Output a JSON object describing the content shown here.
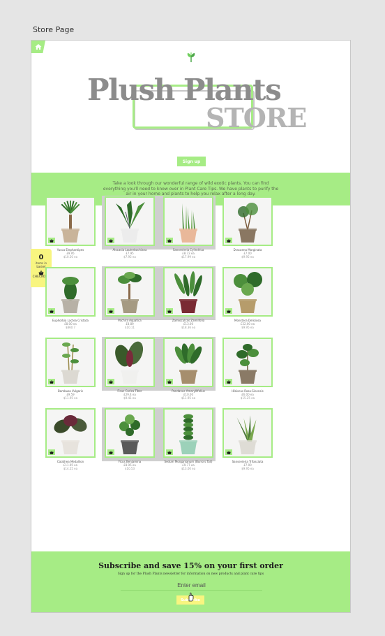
{
  "frame": {
    "label": "Store Page"
  },
  "header": {
    "brand": "Plush Plants",
    "store": "STORE",
    "signup_label": "Sign up"
  },
  "intro": {
    "text": "Take a look through our wonderful range of wild exotic plants. You can find everything you'll need to know over in Plant Care Tips. We have plants to purify the air in your home and plants to help you relax after a long day."
  },
  "basket": {
    "count": "0",
    "items_label": "items in basket",
    "checkout_label": "CHECKOUT"
  },
  "products": [
    {
      "name": "Yucca Elephantipes",
      "price": "£9.95",
      "alt_price": "$10.50 ea",
      "kind": "yucca",
      "pot": "#c9b49a"
    },
    {
      "name": "Alocasia Lauterbachiana",
      "price": "£7.95",
      "alt_price": "$7.95 ea",
      "kind": "alocasia",
      "pot": "#ececec"
    },
    {
      "name": "Sansevieria Cylindrica",
      "price": "£8.72 ea",
      "alt_price": "$17.99 ea",
      "kind": "sansevieria",
      "pot": "#e9b89a"
    },
    {
      "name": "Dracaena Marginata",
      "price": "£7.00",
      "alt_price": "$9.95 ea",
      "kind": "dracaena",
      "pot": "#8a7762"
    },
    {
      "name": "Euphorbia Lactea Cristata",
      "price": "£8.00 ea",
      "alt_price": "$860.7",
      "kind": "euphorbia",
      "pot": "#b7b1a6"
    },
    {
      "name": "Pachira Aquatica",
      "price": "£8.89",
      "alt_price": "$10.11",
      "kind": "pachira",
      "pot": "#a59a82"
    },
    {
      "name": "Zamioculcas Zamiifolia",
      "price": "£13.00",
      "alt_price": "$18.36 ea",
      "kind": "zamio",
      "pot": "#7a2a33"
    },
    {
      "name": "Monstera Deliciosa",
      "price": "£22.00 ea",
      "alt_price": "$9.95 ea",
      "kind": "monstera",
      "pot": "#b69c6b"
    },
    {
      "name": "Bambusa Vulgaris",
      "price": "£9.59",
      "alt_price": "$11.95 ea",
      "kind": "bamboo",
      "pot": "#dcd9d2"
    },
    {
      "name": "Ficus Carica Tiber",
      "price": "£29.4 ea",
      "alt_price": "$9.41 ea",
      "kind": "calathea",
      "pot": "#f0f0ee"
    },
    {
      "name": "Pandanus Amaryllifolius",
      "price": "£10.00",
      "alt_price": "$11.95 ea",
      "kind": "dieffen",
      "pot": "#a68e6d"
    },
    {
      "name": "Hibiscus Rosa-Sinensis",
      "price": "£6.00 ea",
      "alt_price": "$15.25 ea",
      "kind": "ficus",
      "pot": "#8a7a66"
    },
    {
      "name": "Calathea Medallion",
      "price": "£11.95 ea",
      "alt_price": "$14.25 ea",
      "kind": "calathea2",
      "pot": "#e7e3dd"
    },
    {
      "name": "Ficus Benjamina",
      "price": "£8.95 ea",
      "alt_price": "$10.53",
      "kind": "peperomia",
      "pot": "#5a5a5a"
    },
    {
      "name": "Sedum Morganianum (Burro's Tail)",
      "price": "£9.77 ea",
      "alt_price": "$13.00 ea",
      "kind": "spiral",
      "pot": "#9cd1b9"
    },
    {
      "name": "Sansevieria Trifasciata",
      "price": "£7.00",
      "alt_price": "$9.95 ea",
      "kind": "snake",
      "pot": "#dedcd5"
    }
  ],
  "newsletter": {
    "title": "Subscribe and save 15% on your first order",
    "subtitle": "Sign up for the Plush Plants newsletter for information on new products and plant care tips",
    "email_placeholder": "Enter email",
    "subscribe_label": "Subscribe"
  },
  "colors": {
    "accent_green": "#a6ec85",
    "accent_yellow": "#f8f580",
    "title_gray": "#8c8c8c"
  }
}
